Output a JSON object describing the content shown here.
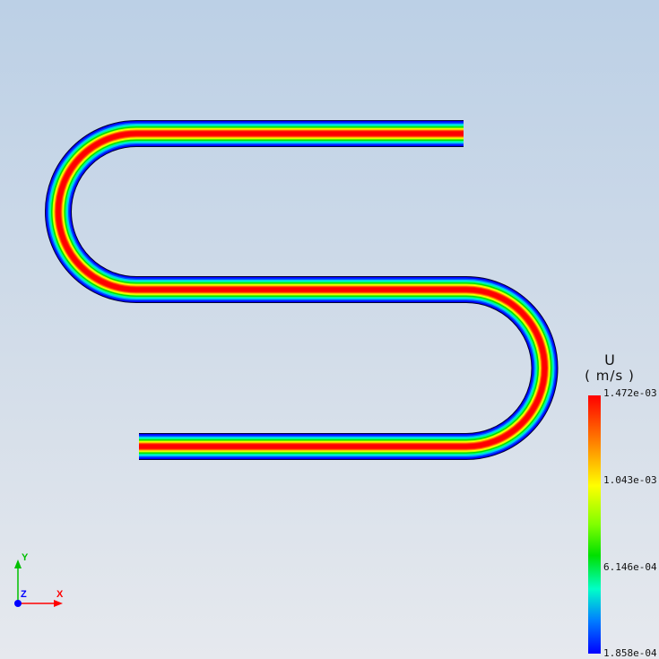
{
  "field": {
    "name": "U",
    "unit": "( m/s )",
    "min": 0.0001858,
    "max": 0.001472,
    "ticks": [
      "1.472e-03",
      "1.043e-03",
      "6.146e-04",
      "1.858e-04"
    ]
  },
  "colors": {
    "scale": [
      "#0000ff",
      "#00c8ff",
      "#00ff80",
      "#00e000",
      "#c8ff00",
      "#ffff00",
      "#ff8000",
      "#ff0000"
    ],
    "x_axis": "#ff0000",
    "y_axis": "#00c000",
    "z_axis": "#0000ff"
  },
  "triad": {
    "x": "X",
    "y": "Y",
    "z": "Z"
  }
}
